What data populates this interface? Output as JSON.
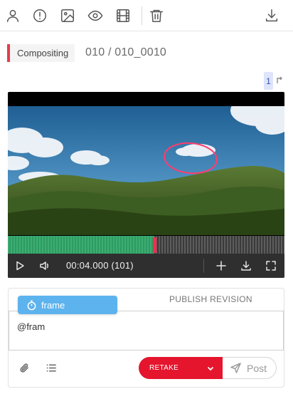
{
  "toolbar": {
    "icons": [
      "user-icon",
      "alert-icon",
      "image-icon",
      "eye-icon",
      "film-icon",
      "trash-icon",
      "download-icon"
    ]
  },
  "task": {
    "type_label": "Compositing",
    "type_color": "#e53c4b",
    "shot_name": "010 / 010_0010"
  },
  "revision": {
    "number": "1"
  },
  "player": {
    "timecode": "00:04.000",
    "frame": "(101)",
    "progress_fraction": 0.53,
    "played_color": "#3cae72",
    "playhead_color": "#ff2a4f"
  },
  "comment": {
    "tab_publish": "PUBLISH REVISION",
    "text": "@fram",
    "mention_suggestion": "frame",
    "retake_label": "RETAKE",
    "post_label": "Post",
    "retake_color": "#e5152e"
  }
}
